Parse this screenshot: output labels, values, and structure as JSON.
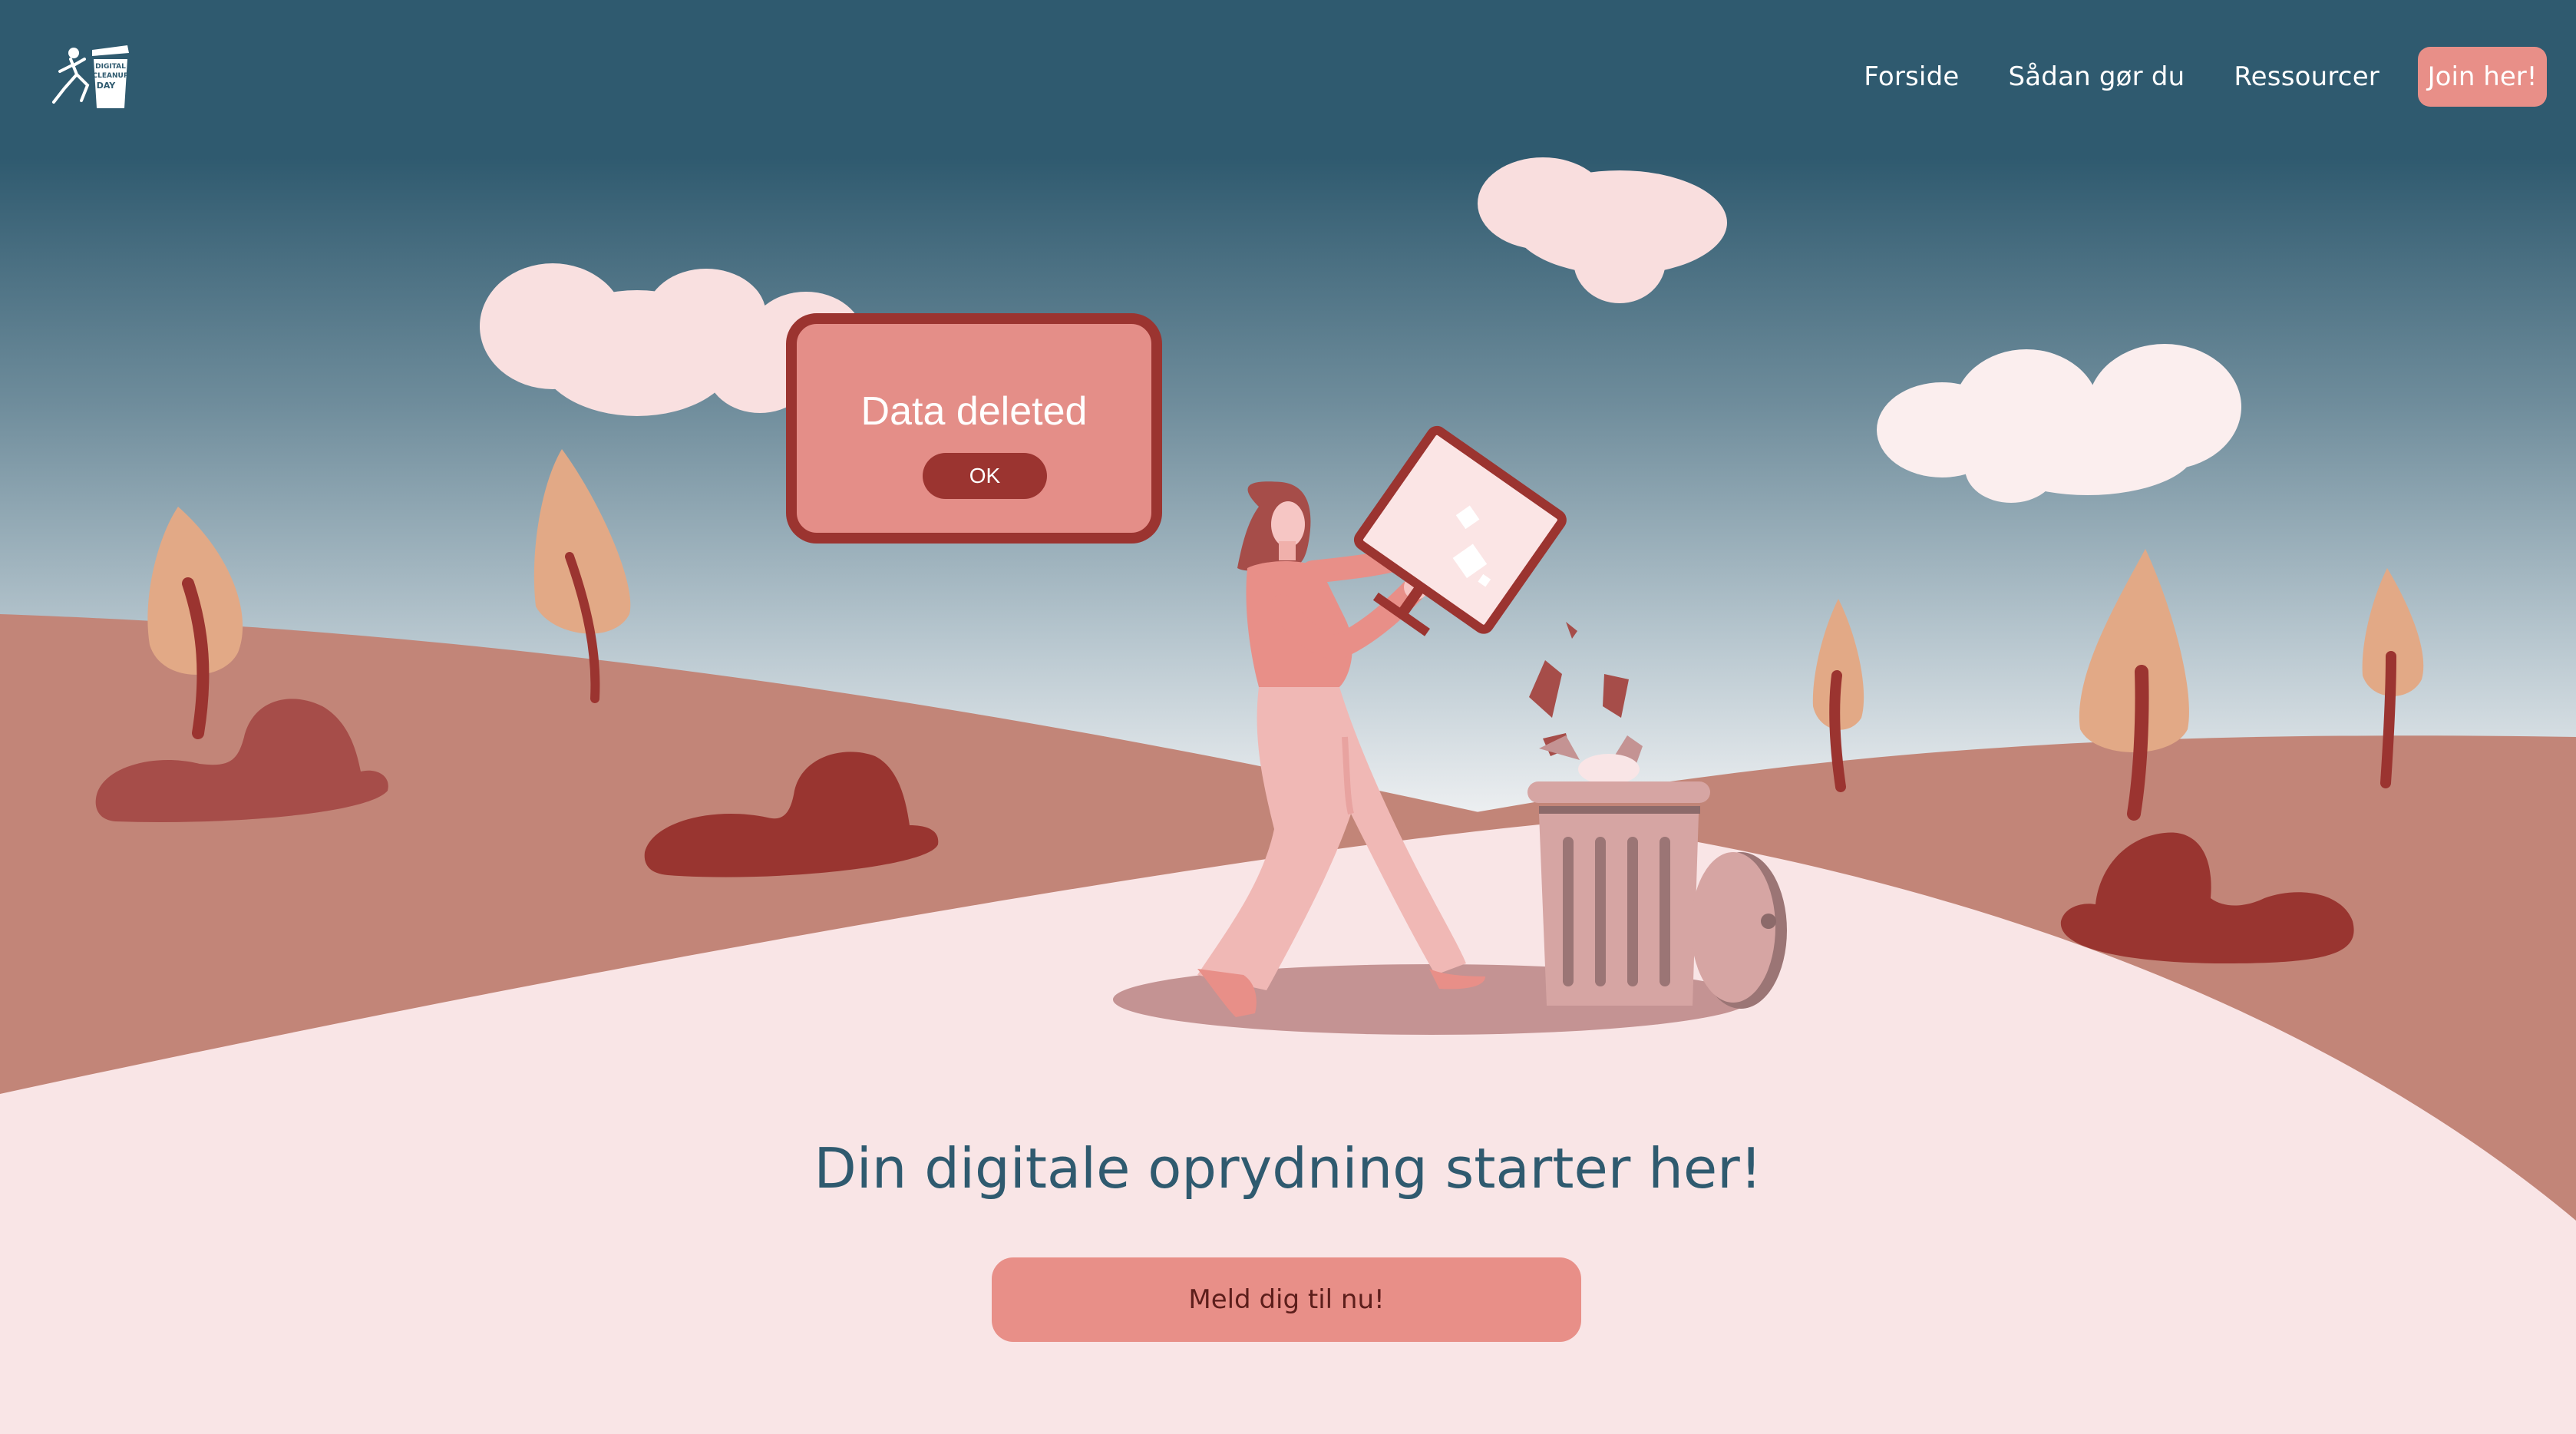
{
  "nav": {
    "links": [
      "Forside",
      "Sådan gør du",
      "Ressourcer"
    ],
    "join_label": "Join her!"
  },
  "logo": {
    "icon": "digital-cleanup-day-logo",
    "text": [
      "DIGITAL",
      "CLEANUP",
      "DAY"
    ]
  },
  "dialog": {
    "message": "Data deleted",
    "ok_label": "OK"
  },
  "hero": {
    "headline": "Din digitale oprydning starter her!",
    "cta_label": "Meld dig til nu!"
  },
  "colors": {
    "sky_top": "#2f5a6f",
    "sky_bottom": "#eef0f2",
    "hill": "#c28578",
    "ground": "#f9e5e6",
    "accent": "#e88f88",
    "dark_red": "#9b3430",
    "tree": "#e2a986",
    "heading": "#2f5a6f"
  }
}
